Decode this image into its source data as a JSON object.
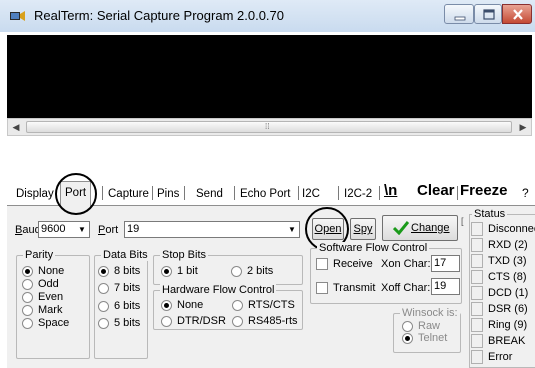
{
  "window": {
    "title": "RealTerm: Serial Capture Program 2.0.0.70"
  },
  "tabs": [
    "Display",
    "Port",
    "Capture",
    "Pins",
    "Send",
    "Echo Port",
    "I2C",
    "I2C-2",
    "\\n",
    "Clear",
    "Freeze",
    "?"
  ],
  "port_panel": {
    "baud_label": "Baud",
    "baud_value": "9600",
    "port_label": "Port",
    "port_value": "19",
    "open_button": "Open",
    "spy_button": "Spy",
    "change_button": "Change",
    "parity": {
      "title": "Parity",
      "options": [
        "None",
        "Odd",
        "Even",
        "Mark",
        "Space"
      ],
      "selected": "None"
    },
    "data_bits": {
      "title": "Data Bits",
      "options": [
        "8 bits",
        "7 bits",
        "6 bits",
        "5 bits"
      ],
      "selected": "8 bits"
    },
    "stop_bits": {
      "title": "Stop Bits",
      "options": [
        "1 bit",
        "2 bits"
      ],
      "selected": "1 bit"
    },
    "hw_flow": {
      "title": "Hardware Flow Control",
      "options": [
        "None",
        "RTS/CTS",
        "DTR/DSR",
        "RS485-rts"
      ],
      "selected": "None"
    },
    "sw_flow": {
      "title": "Software Flow Control",
      "receive_label": "Receive",
      "xon_label": "Xon Char:",
      "xon_value": "17",
      "transmit_label": "Transmit",
      "xoff_label": "Xoff Char:",
      "xoff_value": "19"
    },
    "winsock": {
      "title": "Winsock is:",
      "options": [
        "Raw",
        "Telnet"
      ],
      "selected": "Telnet"
    }
  },
  "status": {
    "title": "Status",
    "items": [
      "Disconnect",
      "RXD (2)",
      "TXD (3)",
      "CTS (8)",
      "DCD (1)",
      "DSR (6)",
      "Ring (9)",
      "BREAK",
      "Error"
    ]
  },
  "colors": {
    "terminal_bg": "#000000",
    "panel_bg": "#f0f0f0",
    "change_check": "#1a9a1a",
    "title_bar": "#c9dbef"
  },
  "icons": {
    "app": "realterm-app-icon",
    "minimize": "minimize-icon",
    "maximize": "maximize-icon",
    "close": "close-icon",
    "change": "green-checkmark-icon"
  }
}
